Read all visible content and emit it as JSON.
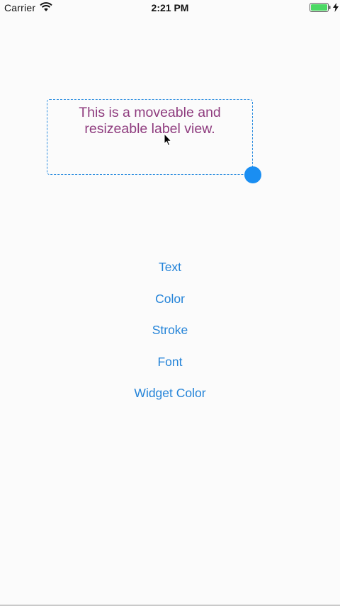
{
  "status_bar": {
    "carrier": "Carrier",
    "time": "2:21 PM",
    "icons": [
      "wifi-icon",
      "battery-icon",
      "charging-icon"
    ],
    "battery_color": "#4cd964"
  },
  "label_widget": {
    "text": "This is a moveable and resizeable label view.",
    "text_color": "#8e3b7e",
    "border_color": "#2f8fe0",
    "handle_color": "#1a8ef2"
  },
  "menu": {
    "items": [
      {
        "label": "Text"
      },
      {
        "label": "Color"
      },
      {
        "label": "Stroke"
      },
      {
        "label": "Font"
      },
      {
        "label": "Widget Color"
      }
    ],
    "color": "#2383d8"
  }
}
